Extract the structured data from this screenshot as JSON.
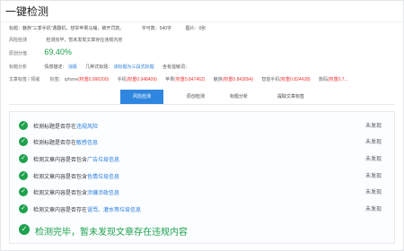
{
  "page": {
    "title": "一键检测"
  },
  "summary": {
    "title_line": "标题：魅族“三季手机”遭翻机，想举苹果马桶，被开罚款。",
    "word_count": "字可数：540字",
    "image_count": "图片：0张"
  },
  "risk_check": {
    "label": "风险检测",
    "text": "检测完毕，暂未发现文章存在违规内容"
  },
  "original_score": {
    "label": "原创分值",
    "value": "69.40%"
  },
  "title_analysis": {
    "label": "标题分析",
    "emotion_label": "情感描述：",
    "emotion_value": "消极",
    "format_label": "几种式标题：",
    "format_value": "该标题为三段式标题",
    "sensitive_label": "含有滥敏词：",
    "sensitive_value": ""
  },
  "keywords": {
    "label": "文章标签 / 领域",
    "prefix": "标签：",
    "items": [
      {
        "word": "iphone",
        "score": "(权重0.996200)"
      },
      {
        "word": "手机",
        "score": "(权重0.948409)"
      },
      {
        "word": "苹果",
        "score": "(权重0.847462)"
      },
      {
        "word": "魅族",
        "score": "(权重0.843894)"
      },
      {
        "word": "智能手机",
        "score": "(权重0.824428)"
      },
      {
        "word": "数码",
        "score": "(权重0.7..."
      }
    ]
  },
  "tabs": [
    {
      "label": "风险检测",
      "active": true
    },
    {
      "label": "原创检测",
      "active": false
    },
    {
      "label": "标题分析",
      "active": false
    },
    {
      "label": "提取文章标签",
      "active": false
    }
  ],
  "checks": [
    {
      "prefix": "检测标题是否存在",
      "highlight": "违规风险",
      "status": "未发现"
    },
    {
      "prefix": "检测标题是否存在",
      "highlight": "敏感信息",
      "status": "未发现"
    },
    {
      "prefix": "检测文章内容是否包含",
      "highlight": "广告垃圾信息",
      "status": "未发现"
    },
    {
      "prefix": "检测文章内容是否包含",
      "highlight": "色情垃圾信息",
      "status": "未发现"
    },
    {
      "prefix": "检测文章内容是否包含",
      "highlight": "涉嫌涉政信息",
      "status": "未发现"
    },
    {
      "prefix": "检测文章内容是否存在",
      "highlight": "谩骂、灌水等垃圾信息",
      "status": "未发现"
    }
  ],
  "final_message": "检测完毕，暂未发现文章存在违规内容",
  "colors": {
    "accent": "#2f86e0",
    "success": "#1ea24d",
    "danger": "#ee3333"
  }
}
